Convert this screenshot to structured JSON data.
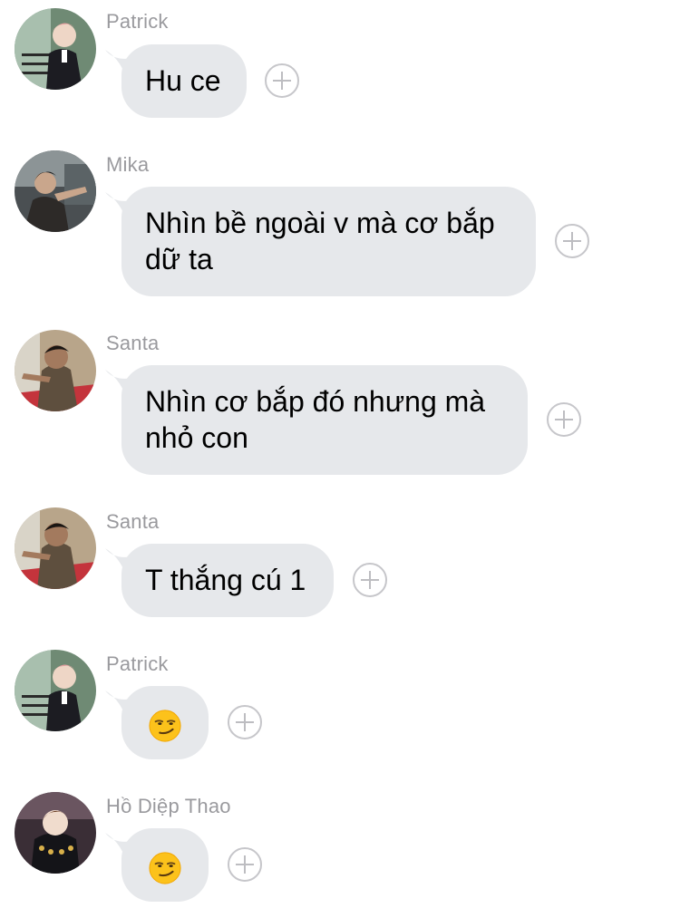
{
  "messages": [
    {
      "sender": "Patrick",
      "text": "Hu ce",
      "avatar": "patrick-avatar"
    },
    {
      "sender": "Mika",
      "text": "Nhìn bề ngoài v mà cơ bắp dữ ta",
      "avatar": "mika-avatar"
    },
    {
      "sender": "Santa",
      "text": "Nhìn cơ bắp đó nhưng mà nhỏ con",
      "avatar": "santa-avatar"
    },
    {
      "sender": "Santa",
      "text": "T thắng cú 1",
      "avatar": "santa-avatar"
    },
    {
      "sender": "Patrick",
      "text": "😏",
      "avatar": "patrick-avatar"
    },
    {
      "sender": "Hồ Diệp Thao",
      "text": "😏",
      "avatar": "ho-diep-thao-avatar"
    }
  ],
  "colors": {
    "bubble": "#e6e8eb",
    "sender_text": "#9a9a9e",
    "react_icon": "#c6c6ca"
  },
  "icons": {
    "reaction": "add-reaction-icon",
    "emoji": "smirking-face-emoji"
  }
}
